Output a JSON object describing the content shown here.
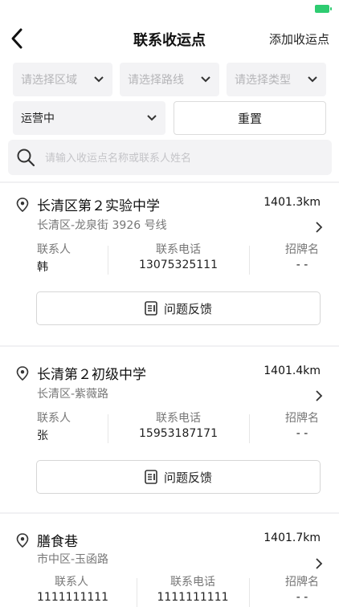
{
  "header": {
    "title": "联系收运点",
    "action": "添加收运点"
  },
  "filters": {
    "area": "请选择区域",
    "route": "请选择路线",
    "type": "请选择类型",
    "status": "运营中",
    "reset": "重置"
  },
  "search": {
    "placeholder": "请输入收运点名称或联系人姓名"
  },
  "labels": {
    "contact": "联系人",
    "phone": "联系电话",
    "sign": "招牌名",
    "feedback": "问题反馈"
  },
  "points": [
    {
      "name": "长清区第２实验中学",
      "distance": "1401.3km",
      "address": "长清区-龙泉街 3926 号线",
      "contact": "韩",
      "phone": "13075325111",
      "sign": "- -"
    },
    {
      "name": "长清第２初级中学",
      "distance": "1401.4km",
      "address": "长清区-紫薇路",
      "contact": "张",
      "phone": "15953187171",
      "sign": "- -"
    },
    {
      "name": "膳食巷",
      "distance": "1401.7km",
      "address": "市中区-玉函路",
      "contact": "1111111111",
      "phone": "1111111111",
      "sign": "- -"
    }
  ]
}
